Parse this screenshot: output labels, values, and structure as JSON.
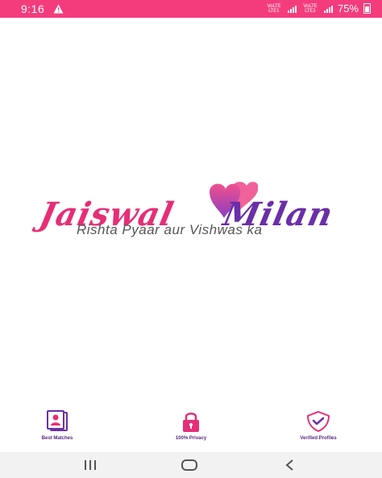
{
  "status_bar": {
    "time": "9:16",
    "network_label_1": "VoLTE LTE1",
    "network_label_2": "VoLTE LTE2",
    "battery": "75%",
    "icons": [
      "warning-icon",
      "signal-icon",
      "signal-icon",
      "battery-icon"
    ]
  },
  "brand": {
    "name_left": "Jaiswal",
    "name_right": "Milan",
    "tagline": "Rishta Pyaar aur Vishwas ka",
    "colors": {
      "left": "#e62e76",
      "right": "#6a2fa8",
      "heart_top": "#f0508f",
      "heart_bottom": "#8a3fc0"
    }
  },
  "features": [
    {
      "label": "Best Matches",
      "icon": "profile-card-icon"
    },
    {
      "label": "100% Privacy",
      "icon": "lock-icon"
    },
    {
      "label": "Verified Profiles",
      "icon": "shield-check-icon"
    }
  ],
  "nav_bar": {
    "icons": [
      "recents-icon",
      "home-icon",
      "back-icon"
    ]
  },
  "colors": {
    "status_bar": "#f43c7d",
    "accent_pink": "#e62e76",
    "accent_purple": "#5a2a82"
  }
}
